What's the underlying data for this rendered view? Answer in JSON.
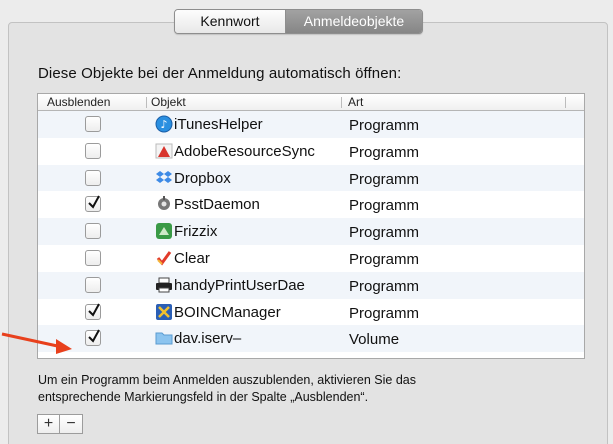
{
  "tabs": [
    {
      "label": "Kennwort",
      "active": false
    },
    {
      "label": "Anmeldeobjekte",
      "active": true
    }
  ],
  "heading": "Diese Objekte bei der Anmeldung automatisch öffnen:",
  "table": {
    "columns": [
      "Ausblenden",
      "Objekt",
      "Art"
    ],
    "rows": [
      {
        "hidden": false,
        "icon": "itunes-helper-icon",
        "name": "iTunesHelper",
        "type": "Programm"
      },
      {
        "hidden": false,
        "icon": "adobe-resource-sync-icon",
        "name": "AdobeResourceSync",
        "type": "Programm"
      },
      {
        "hidden": false,
        "icon": "dropbox-icon",
        "name": "Dropbox",
        "type": "Programm"
      },
      {
        "hidden": true,
        "icon": "psst-daemon-icon",
        "name": "PsstDaemon",
        "type": "Programm"
      },
      {
        "hidden": false,
        "icon": "frizzix-icon",
        "name": "Frizzix",
        "type": "Programm"
      },
      {
        "hidden": false,
        "icon": "clear-icon",
        "name": "Clear",
        "type": "Programm"
      },
      {
        "hidden": false,
        "icon": "printer-icon",
        "name": "handyPrintUserDae",
        "type": "Programm"
      },
      {
        "hidden": true,
        "icon": "boinc-manager-icon",
        "name": "BOINCManager",
        "type": "Programm"
      },
      {
        "hidden": true,
        "icon": "folder-icon",
        "name": "dav.iserv–",
        "type": "Volume"
      }
    ]
  },
  "hint": {
    "line1": "Um ein Programm beim Anmelden auszublenden, aktivieren Sie das",
    "line2": "entsprechende Markierungsfeld in der Spalte „Ausblenden“."
  },
  "buttons": {
    "add": "+",
    "remove": "−"
  },
  "colors": {
    "accent_arrow": "#e8401c",
    "active_tab": "#8d8d8d"
  }
}
